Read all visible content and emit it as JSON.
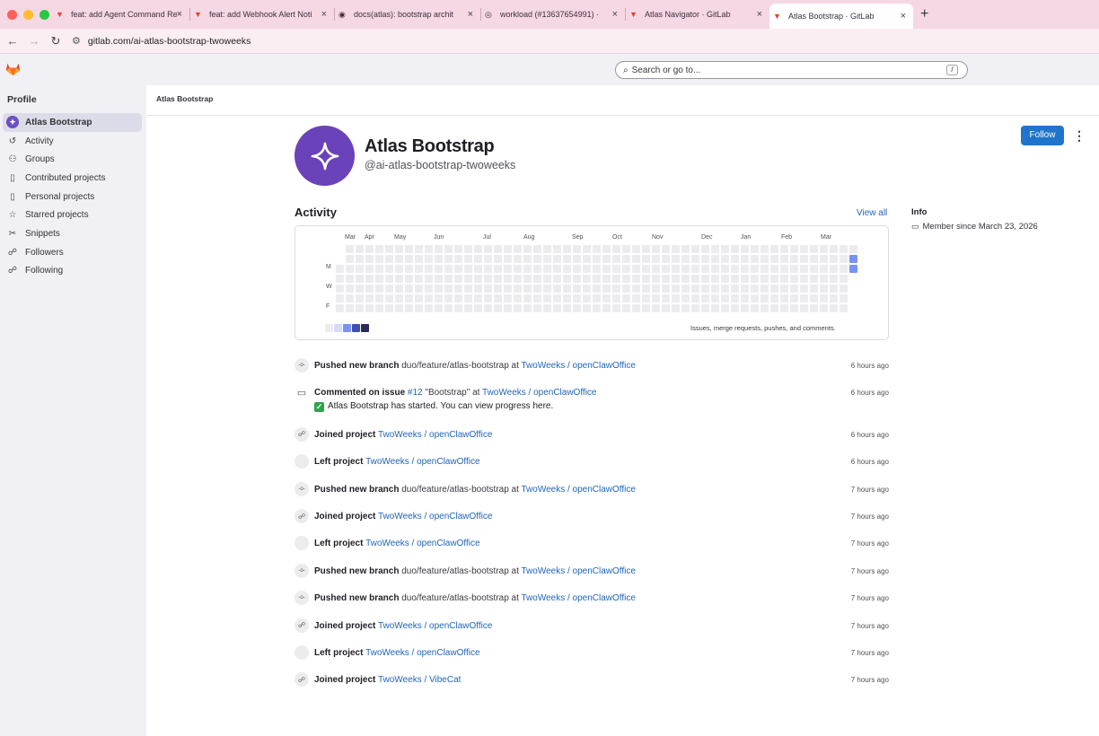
{
  "browser": {
    "tabs": [
      {
        "label": "feat: add Agent Command Re",
        "icon": "gitlab-icon"
      },
      {
        "label": "feat: add Webhook Alert Noti",
        "icon": "gitlab-icon"
      },
      {
        "label": "docs(atlas): bootstrap archit",
        "icon": "github-icon"
      },
      {
        "label": "workload (#13637654991) ·",
        "icon": "chrome-icon"
      },
      {
        "label": "Atlas Navigator · GitLab",
        "icon": "gitlab-icon"
      },
      {
        "label": "Atlas Bootstrap · GitLab",
        "icon": "gitlab-icon",
        "active": true
      }
    ],
    "url": "gitlab.com/ai-atlas-bootstrap-twoweeks"
  },
  "header": {
    "search_placeholder": "Search or go to...",
    "search_shortcut": "/"
  },
  "sidebar": {
    "title": "Profile",
    "items": [
      {
        "label": "Atlas Bootstrap",
        "icon": "sparkle-icon",
        "active": true
      },
      {
        "label": "Activity",
        "icon": "history-icon"
      },
      {
        "label": "Groups",
        "icon": "group-icon"
      },
      {
        "label": "Contributed projects",
        "icon": "project-icon"
      },
      {
        "label": "Personal projects",
        "icon": "project-icon"
      },
      {
        "label": "Starred projects",
        "icon": "star-icon"
      },
      {
        "label": "Snippets",
        "icon": "snippet-icon"
      },
      {
        "label": "Followers",
        "icon": "users-icon"
      },
      {
        "label": "Following",
        "icon": "users-icon"
      }
    ]
  },
  "breadcrumb": "Atlas Bootstrap",
  "profile": {
    "name": "Atlas Bootstrap",
    "handle": "@ai-atlas-bootstrap-twoweeks",
    "follow_label": "Follow"
  },
  "activity": {
    "title": "Activity",
    "view_all": "View all",
    "months": [
      "Mar",
      "Apr",
      "May",
      "Jun",
      "Jul",
      "Aug",
      "Sep",
      "Oct",
      "Nov",
      "Dec",
      "Jan",
      "Feb",
      "Mar"
    ],
    "day_labels": [
      "M",
      "W",
      "F"
    ],
    "legend_caption": "Issues, merge requests, pushes, and comments.",
    "colors": {
      "empty": "#ececef",
      "level1": "#d2dcff",
      "level2": "#7992f5",
      "level3": "#3f51ae",
      "level4": "#2a2b59"
    },
    "recent_week_levels": [
      0,
      2,
      2,
      1,
      0,
      0,
      0
    ]
  },
  "info": {
    "title": "Info",
    "member_since": "Member since March 23, 2026"
  },
  "events": [
    {
      "icon": "commit-icon",
      "action": "Pushed new branch",
      "middle": "duo/feature/atlas-bootstrap at",
      "link": "TwoWeeks / openClawOffice",
      "time": "6 hours ago"
    },
    {
      "icon": "comment-icon",
      "action": "Commented on issue",
      "issue": "#12",
      "middle": "\"Bootstrap\" at",
      "link": "TwoWeeks / openClawOffice",
      "time": "6 hours ago",
      "body": "Atlas Bootstrap has started. You can view progress here."
    },
    {
      "icon": "users-icon",
      "action": "Joined project",
      "middle": "",
      "link": "TwoWeeks / openClawOffice",
      "time": "6 hours ago"
    },
    {
      "icon": "blank-icon",
      "action": "Left project",
      "middle": "",
      "link": "TwoWeeks / openClawOffice",
      "time": "6 hours ago"
    },
    {
      "icon": "commit-icon",
      "action": "Pushed new branch",
      "middle": "duo/feature/atlas-bootstrap at",
      "link": "TwoWeeks / openClawOffice",
      "time": "7 hours ago"
    },
    {
      "icon": "users-icon",
      "action": "Joined project",
      "middle": "",
      "link": "TwoWeeks / openClawOffice",
      "time": "7 hours ago"
    },
    {
      "icon": "blank-icon",
      "action": "Left project",
      "middle": "",
      "link": "TwoWeeks / openClawOffice",
      "time": "7 hours ago"
    },
    {
      "icon": "commit-icon",
      "action": "Pushed new branch",
      "middle": "duo/feature/atlas-bootstrap at",
      "link": "TwoWeeks / openClawOffice",
      "time": "7 hours ago"
    },
    {
      "icon": "commit-icon",
      "action": "Pushed new branch",
      "middle": "duo/feature/atlas-bootstrap at",
      "link": "TwoWeeks / openClawOffice",
      "time": "7 hours ago"
    },
    {
      "icon": "users-icon",
      "action": "Joined project",
      "middle": "",
      "link": "TwoWeeks / openClawOffice",
      "time": "7 hours ago"
    },
    {
      "icon": "blank-icon",
      "action": "Left project",
      "middle": "",
      "link": "TwoWeeks / openClawOffice",
      "time": "7 hours ago"
    },
    {
      "icon": "users-icon",
      "action": "Joined project",
      "middle": "",
      "link": "TwoWeeks / VibeCat",
      "time": "7 hours ago"
    }
  ]
}
